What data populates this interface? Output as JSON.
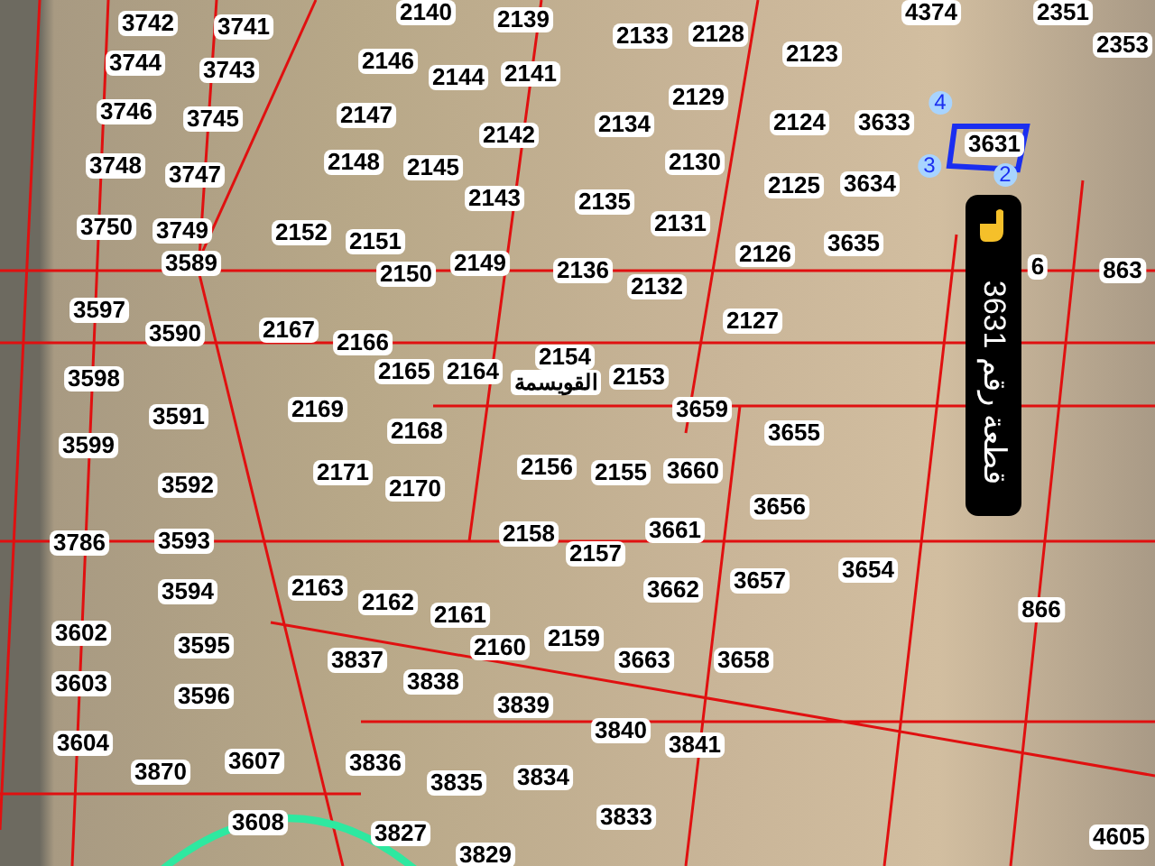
{
  "map": {
    "parcels": [
      "3742",
      "3741",
      "3744",
      "3743",
      "3746",
      "3745",
      "3748",
      "3747",
      "3750",
      "3749",
      "3589",
      "3597",
      "3590",
      "3598",
      "3591",
      "3599",
      "3592",
      "3786",
      "3593",
      "3594",
      "3602",
      "3595",
      "3603",
      "3596",
      "3604",
      "3870",
      "3607",
      "3608",
      "2140",
      "2139",
      "2146",
      "2144",
      "2141",
      "2147",
      "2142",
      "2148",
      "2145",
      "2143",
      "2152",
      "2151",
      "2150",
      "2149",
      "2136",
      "2167",
      "2166",
      "2165",
      "2164",
      "2154",
      "2153",
      "2169",
      "2168",
      "2171",
      "2170",
      "2156",
      "2155",
      "3659",
      "3660",
      "3655",
      "2158",
      "2157",
      "3661",
      "3656",
      "2163",
      "2162",
      "2161",
      "2160",
      "2159",
      "3662",
      "3657",
      "3654",
      "866",
      "3837",
      "3663",
      "3658",
      "3838",
      "3839",
      "3840",
      "3841",
      "3836",
      "3835",
      "3834",
      "3833",
      "3827",
      "3829",
      "4605",
      "2133",
      "2128",
      "2129",
      "2134",
      "2130",
      "2135",
      "2131",
      "2132",
      "2123",
      "2124",
      "3633",
      "3631",
      "2125",
      "3634",
      "2126",
      "3635",
      "2127",
      "4374",
      "2351",
      "2353",
      "6",
      "863"
    ],
    "road_label": "القويسمة",
    "plot_vertices": [
      "4",
      "3",
      "2"
    ],
    "badge": {
      "text": "قطعة رقم 3631"
    }
  }
}
